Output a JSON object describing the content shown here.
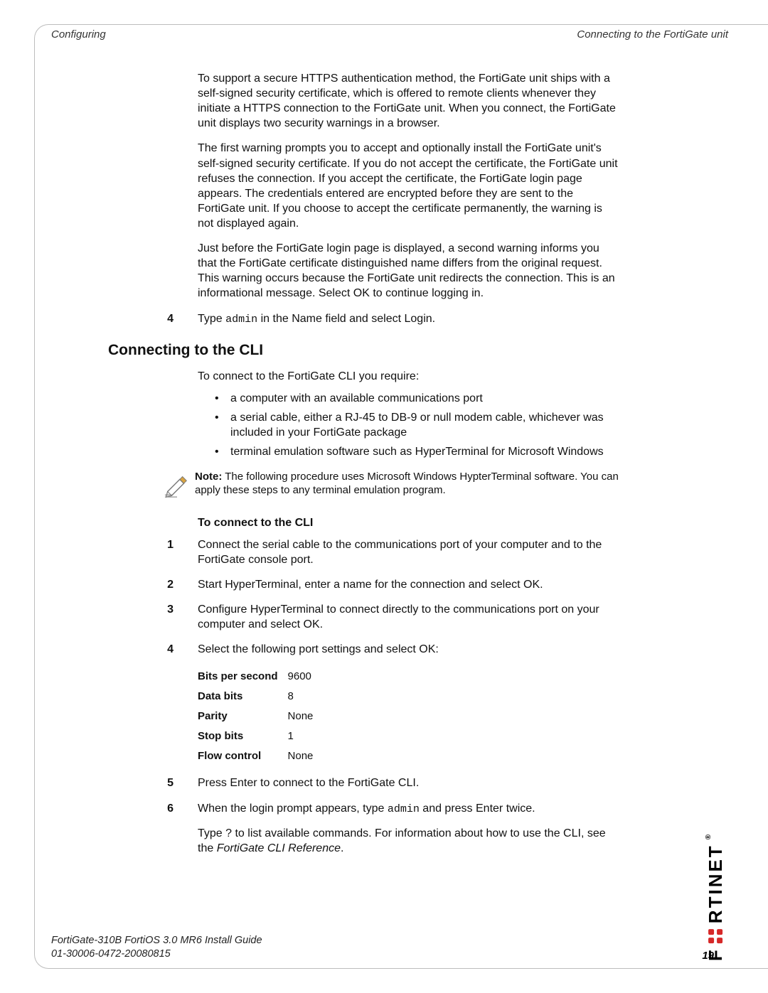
{
  "header": {
    "left": "Configuring",
    "right": "Connecting to the FortiGate unit"
  },
  "p1": "To support a secure HTTPS authentication method, the FortiGate unit ships with a self-signed security certificate, which is offered to remote clients whenever they initiate a HTTPS connection to the FortiGate unit. When you connect, the FortiGate unit displays two security warnings in a browser.",
  "p2": "The first warning prompts you to accept and optionally install the FortiGate unit's self-signed security certificate. If you do not accept the certificate, the FortiGate unit refuses the connection. If you accept the certificate, the FortiGate login page appears. The credentials entered are encrypted before they are sent to the FortiGate unit. If you choose to accept the certificate permanently, the warning is not displayed again.",
  "p3": "Just before the FortiGate login page is displayed, a second warning informs you that the FortiGate certificate distinguished name differs from the original request. This warning occurs because the FortiGate unit redirects the connection. This is an informational message. Select OK to continue logging in.",
  "step4_num": "4",
  "step4_pre": "Type ",
  "step4_code": "admin",
  "step4_post": " in the Name field and select Login.",
  "h2": "Connecting to the CLI",
  "cli_intro": "To connect to the FortiGate CLI you require:",
  "bullets": [
    "a computer with an available communications port",
    "a serial cable, either a RJ-45 to DB-9 or null modem cable, whichever was included in your FortiGate package",
    "terminal emulation software such as HyperTerminal for Microsoft Windows"
  ],
  "note_label": "Note:",
  "note_body": " The following procedure uses Microsoft Windows HypterTerminal software. You can apply these steps to any terminal emulation program.",
  "subhead": "To connect to the CLI",
  "steps": [
    {
      "n": "1",
      "t": "Connect the serial cable to the communications port of your computer and to the FortiGate console port."
    },
    {
      "n": "2",
      "t": "Start HyperTerminal, enter a name for the connection and select OK."
    },
    {
      "n": "3",
      "t": "Configure HyperTerminal to connect directly to the communications port on your computer and select OK."
    },
    {
      "n": "4",
      "t": "Select the following port settings and select OK:"
    }
  ],
  "settings": [
    {
      "k": "Bits per second",
      "v": "9600"
    },
    {
      "k": "Data bits",
      "v": "8"
    },
    {
      "k": "Parity",
      "v": "None"
    },
    {
      "k": "Stop bits",
      "v": "1"
    },
    {
      "k": "Flow control",
      "v": "None"
    }
  ],
  "step5_num": "5",
  "step5_text": "Press Enter to connect to the FortiGate CLI.",
  "step6_num": "6",
  "step6_pre": "When the login prompt appears, type ",
  "step6_code": "admin",
  "step6_post": " and press Enter twice.",
  "final_pre": "Type ? to list available commands. For information about how to use the CLI, see the ",
  "final_ital": "FortiGate CLI Reference",
  "final_post": ".",
  "footer": {
    "line1": "FortiGate-310B FortiOS 3.0 MR6 Install Guide",
    "line2": "01-30006-0472-20080815",
    "page": "19"
  },
  "brand_text": "RTINET",
  "brand_reg": "®"
}
